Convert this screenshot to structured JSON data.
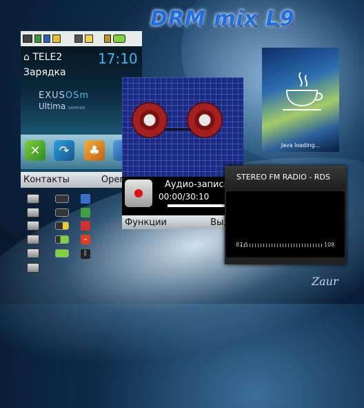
{
  "title": "DRM mix L9",
  "standby": {
    "operator": "TELE2",
    "time": "17:10",
    "status_text": "Зарядка",
    "logo_line1": "EXUS",
    "logo_line1b": "OSm",
    "logo_line2": "Ultima",
    "logo_line2b": "SAPPHIRE",
    "softkey_left": "Контакты",
    "softkey_right": "Opera M"
  },
  "recorder": {
    "title": "Аудио-запись",
    "time": "00:00/30:10",
    "softkey_left": "Функции",
    "softkey_right": "Выход"
  },
  "java": {
    "loading": "Java loading..."
  },
  "radio": {
    "header": "STEREO FM RADIO - RDS",
    "freq_min": "87.5",
    "freq_max": "108"
  },
  "signature": "Zaur",
  "colors": {
    "title_blue": "#1f6fe0",
    "clock_blue": "#39b9f0",
    "record_red": "#e01010",
    "battery_green": "#7fd23a"
  }
}
